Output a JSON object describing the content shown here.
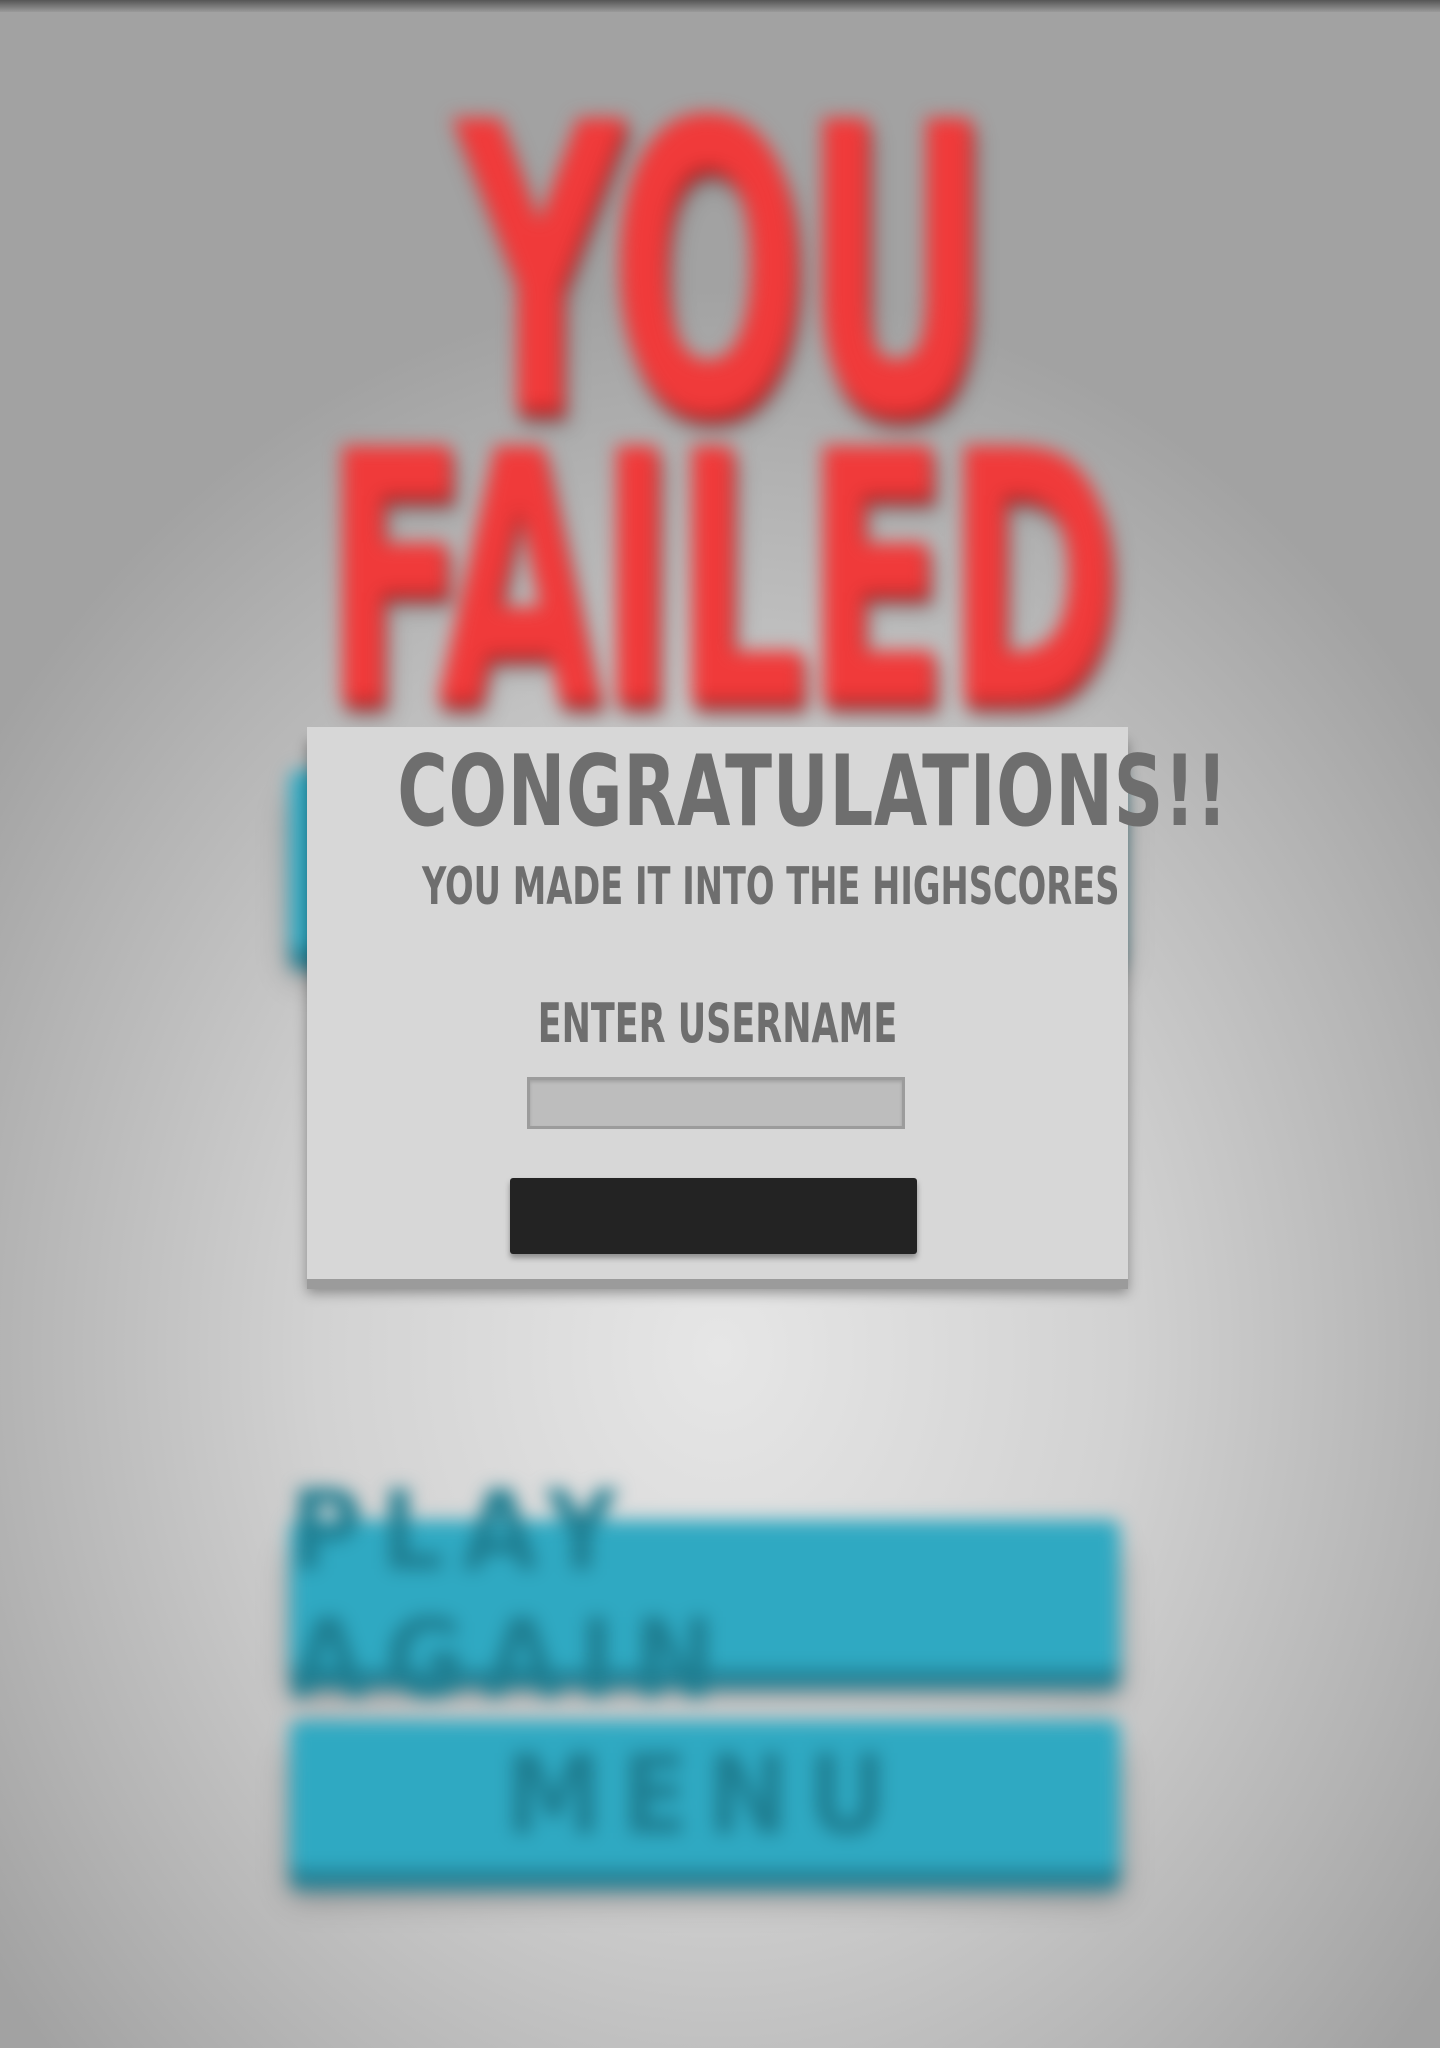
{
  "background": {
    "failed_line1": "YOU",
    "failed_line2": "FAILED",
    "play_again_label": "PLAY AGAIN",
    "menu_label": "MENU"
  },
  "dialog": {
    "title": "CONGRATULATIONS!!",
    "subtitle": "YOU MADE IT INTO THE HIGHSCORES",
    "username_label": "ENTER USERNAME",
    "username_value": "",
    "submit_label": ""
  },
  "colors": {
    "failed_red": "#f03a3a",
    "button_teal": "#2fa9c2",
    "dialog_bg": "#d7d7d7",
    "dialog_text": "#6e6e6e",
    "submit_bg": "#232323"
  }
}
